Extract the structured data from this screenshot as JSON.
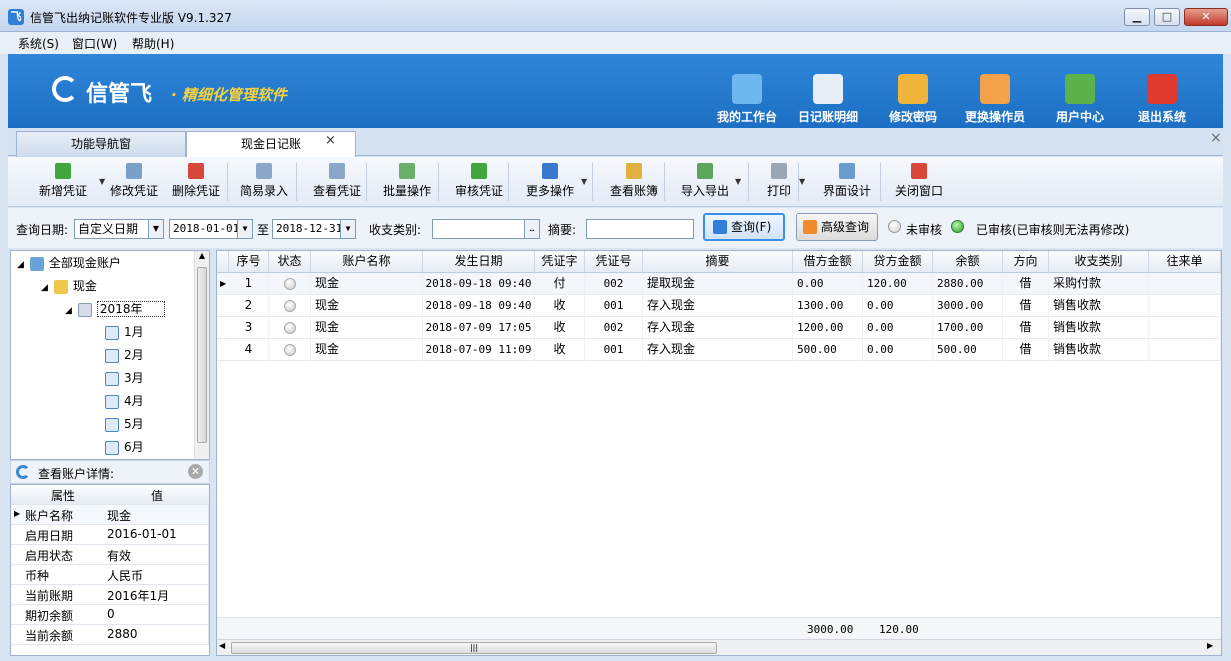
{
  "window": {
    "title": "信管飞出纳记账软件专业版 V9.1.327"
  },
  "menu": [
    "系统(S)",
    "窗口(W)",
    "帮助(H)"
  ],
  "banner": {
    "logo_text": "信管飞",
    "slogan": "· 精细化管理软件",
    "buttons": [
      {
        "label": "我的工作台",
        "icon": "monitor-icon",
        "color": "#6fb7ef"
      },
      {
        "label": "日记账明细",
        "icon": "ledger-list-icon",
        "color": "#e8eef7"
      },
      {
        "label": "修改密码",
        "icon": "lock-icon",
        "color": "#f0b43a"
      },
      {
        "label": "更换操作员",
        "icon": "user-icon",
        "color": "#f3a24a"
      },
      {
        "label": "用户中心",
        "icon": "globe-icon",
        "color": "#5db34b"
      },
      {
        "label": "退出系统",
        "icon": "power-icon",
        "color": "#e03a2e"
      }
    ]
  },
  "tabs": {
    "nav": "功能导航窗",
    "cash": "现金日记账",
    "close": "×"
  },
  "toolbar": [
    {
      "label": "新增凭证",
      "icon": "add-icon",
      "color": "#41a63c",
      "drop": true
    },
    {
      "label": "修改凭证",
      "icon": "edit-icon",
      "color": "#7aa0c8"
    },
    {
      "label": "删除凭证",
      "icon": "delete-icon",
      "color": "#d9463a"
    },
    {
      "label": "简易录入",
      "icon": "grid-icon",
      "color": "#8aa6c8"
    },
    {
      "label": "查看凭证",
      "icon": "view-icon",
      "color": "#8aa6c8"
    },
    {
      "label": "批量操作",
      "icon": "batch-icon",
      "color": "#6ab06a"
    },
    {
      "label": "审核凭证",
      "icon": "check-icon",
      "color": "#41a63c"
    },
    {
      "label": "更多操作",
      "icon": "more-icon",
      "color": "#3a78cf",
      "drop": true
    },
    {
      "label": "查看账簿",
      "icon": "book-icon",
      "color": "#e0b040"
    },
    {
      "label": "导入导出",
      "icon": "import-export-icon",
      "color": "#5da45d",
      "drop": true
    },
    {
      "label": "打印",
      "icon": "print-icon",
      "color": "#9aa6b4",
      "drop": true
    },
    {
      "label": "界面设计",
      "icon": "layout-icon",
      "color": "#6a9ad0"
    },
    {
      "label": "关闭窗口",
      "icon": "close-window-icon",
      "color": "#d9463a"
    }
  ],
  "filter": {
    "date_label": "查询日期:",
    "date_mode": "自定义日期",
    "date_from": "2018-01-01",
    "to_label": "至",
    "date_to": "2018-12-31",
    "category_label": "收支类别:",
    "category_value": "",
    "ellipsis": "…",
    "summary_label": "摘要:",
    "summary_value": "",
    "query_button": "查询(F)",
    "advanced_button": "高级查询",
    "unaudited_label": "未审核",
    "audited_label": "已审核(已审核则无法再修改)"
  },
  "tree": {
    "root": "全部现金账户",
    "account": "现金",
    "year": "2018年",
    "months": [
      "1月",
      "2月",
      "3月",
      "4月",
      "5月",
      "6月"
    ]
  },
  "detail": {
    "title": "查看账户详情:",
    "headers": [
      "属性",
      "值"
    ],
    "rows": [
      {
        "k": "账户名称",
        "v": "现金"
      },
      {
        "k": "启用日期",
        "v": "2016-01-01"
      },
      {
        "k": "启用状态",
        "v": "有效"
      },
      {
        "k": "币种",
        "v": "人民币"
      },
      {
        "k": "当前账期",
        "v": "2016年1月"
      },
      {
        "k": "期初余额",
        "v": "0"
      },
      {
        "k": "当前余额",
        "v": "2880"
      }
    ]
  },
  "grid": {
    "columns": [
      "序号",
      "状态",
      "账户名称",
      "发生日期",
      "凭证字",
      "凭证号",
      "摘要",
      "借方金额",
      "贷方金额",
      "余额",
      "方向",
      "收支类别",
      "往来单"
    ],
    "rows": [
      {
        "no": "1",
        "account": "现金",
        "date": "2018-09-18 09:40",
        "word": "付",
        "num": "002",
        "summary": "提取现金",
        "debit": "0.00",
        "credit": "120.00",
        "balance": "2880.00",
        "dir": "借",
        "category": "采购付款"
      },
      {
        "no": "2",
        "account": "现金",
        "date": "2018-09-18 09:40",
        "word": "收",
        "num": "001",
        "summary": "存入现金",
        "debit": "1300.00",
        "credit": "0.00",
        "balance": "3000.00",
        "dir": "借",
        "category": "销售收款"
      },
      {
        "no": "3",
        "account": "现金",
        "date": "2018-07-09 17:05",
        "word": "收",
        "num": "002",
        "summary": "存入现金",
        "debit": "1200.00",
        "credit": "0.00",
        "balance": "1700.00",
        "dir": "借",
        "category": "销售收款"
      },
      {
        "no": "4",
        "account": "现金",
        "date": "2018-07-09 11:09",
        "word": "收",
        "num": "001",
        "summary": "存入现金",
        "debit": "500.00",
        "credit": "0.00",
        "balance": "500.00",
        "dir": "借",
        "category": "销售收款"
      }
    ],
    "total_debit": "3000.00",
    "total_credit": "120.00"
  }
}
